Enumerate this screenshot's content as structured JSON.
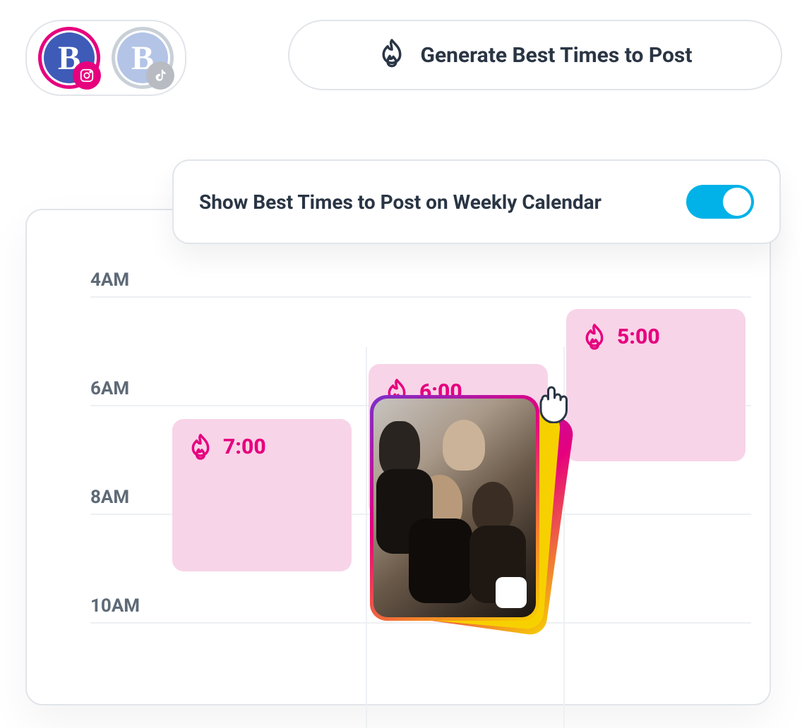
{
  "accounts": [
    {
      "brand_letter": "B",
      "platform": "instagram",
      "active": true
    },
    {
      "brand_letter": "B",
      "platform": "tiktok",
      "active": false
    }
  ],
  "generate_button": {
    "label": "Generate Best Times to Post"
  },
  "toggle_row": {
    "label": "Show Best Times to Post on Weekly Calendar",
    "enabled": true
  },
  "calendar": {
    "time_labels": [
      "4AM",
      "6AM",
      "8AM",
      "10AM"
    ],
    "slots": [
      {
        "time": "7:00",
        "column": 0
      },
      {
        "time": "6:00",
        "column": 1
      },
      {
        "time": "5:00",
        "column": 2
      }
    ]
  },
  "colors": {
    "accent_pink": "#E6007E",
    "accent_blue": "#00B2E8",
    "slot_fill": "#F8D4E8",
    "text_dark": "#2A3544"
  }
}
